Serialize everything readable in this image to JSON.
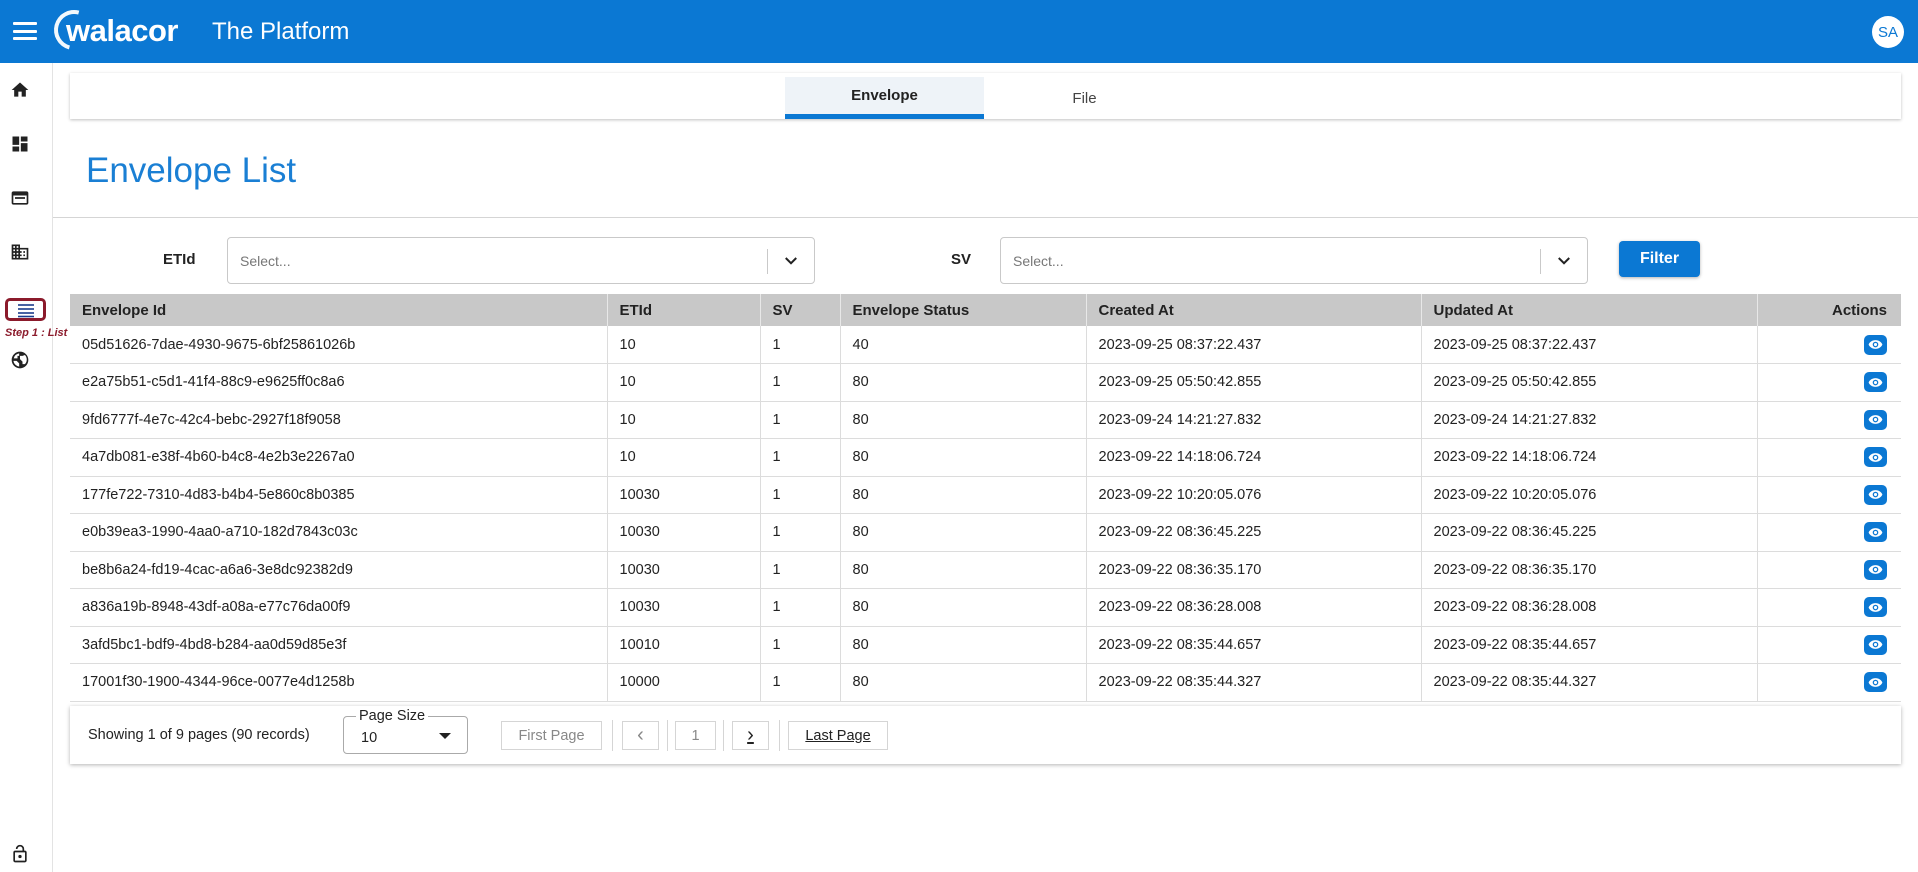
{
  "header": {
    "logo_text": "walacor",
    "title": "The Platform",
    "avatar_initials": "SA",
    "bar_color": "#0b78d3"
  },
  "rail": {
    "items": [
      "home-icon",
      "dashboard-icon",
      "schema-icon",
      "organization-icon",
      "list-icon",
      "dashboard-globe-icon",
      "lock-icon"
    ],
    "active_step_label": "Step 1 : List"
  },
  "tabs": [
    {
      "label": "Envelope",
      "active": true
    },
    {
      "label": "File",
      "active": false
    }
  ],
  "page": {
    "title": "Envelope List"
  },
  "filters": {
    "etid_label": "ETId",
    "etid_placeholder": "Select...",
    "sv_label": "SV",
    "sv_placeholder": "Select...",
    "filter_button": "Filter"
  },
  "table": {
    "columns": [
      "Envelope Id",
      "ETId",
      "SV",
      "Envelope Status",
      "Created At",
      "Updated At",
      "Actions"
    ],
    "rows": [
      [
        "05d51626-7dae-4930-9675-6bf25861026b",
        "10",
        "1",
        "40",
        "2023-09-25 08:37:22.437",
        "2023-09-25 08:37:22.437"
      ],
      [
        "e2a75b51-c5d1-41f4-88c9-e9625ff0c8a6",
        "10",
        "1",
        "80",
        "2023-09-25 05:50:42.855",
        "2023-09-25 05:50:42.855"
      ],
      [
        "9fd6777f-4e7c-42c4-bebc-2927f18f9058",
        "10",
        "1",
        "80",
        "2023-09-24 14:21:27.832",
        "2023-09-24 14:21:27.832"
      ],
      [
        "4a7db081-e38f-4b60-b4c8-4e2b3e2267a0",
        "10",
        "1",
        "80",
        "2023-09-22 14:18:06.724",
        "2023-09-22 14:18:06.724"
      ],
      [
        "177fe722-7310-4d83-b4b4-5e860c8b0385",
        "10030",
        "1",
        "80",
        "2023-09-22 10:20:05.076",
        "2023-09-22 10:20:05.076"
      ],
      [
        "e0b39ea3-1990-4aa0-a710-182d7843c03c",
        "10030",
        "1",
        "80",
        "2023-09-22 08:36:45.225",
        "2023-09-22 08:36:45.225"
      ],
      [
        "be8b6a24-fd19-4cac-a6a6-3e8dc92382d9",
        "10030",
        "1",
        "80",
        "2023-09-22 08:36:35.170",
        "2023-09-22 08:36:35.170"
      ],
      [
        "a836a19b-8948-43df-a08a-e77c76da00f9",
        "10030",
        "1",
        "80",
        "2023-09-22 08:36:28.008",
        "2023-09-22 08:36:28.008"
      ],
      [
        "3afd5bc1-bdf9-4bd8-b284-aa0d59d85e3f",
        "10010",
        "1",
        "80",
        "2023-09-22 08:35:44.657",
        "2023-09-22 08:35:44.657"
      ],
      [
        "17001f30-1900-4344-96ce-0077e4d1258b",
        "10000",
        "1",
        "80",
        "2023-09-22 08:35:44.327",
        "2023-09-22 08:35:44.327"
      ]
    ],
    "action_icon": "eye-icon"
  },
  "pagination": {
    "info": "Showing 1 of 9 pages (90 records)",
    "page_size_label": "Page Size",
    "page_size_value": "10",
    "first_page": "First Page",
    "prev": "‹",
    "current_page": "1",
    "next": "›",
    "last_page": "Last Page"
  }
}
